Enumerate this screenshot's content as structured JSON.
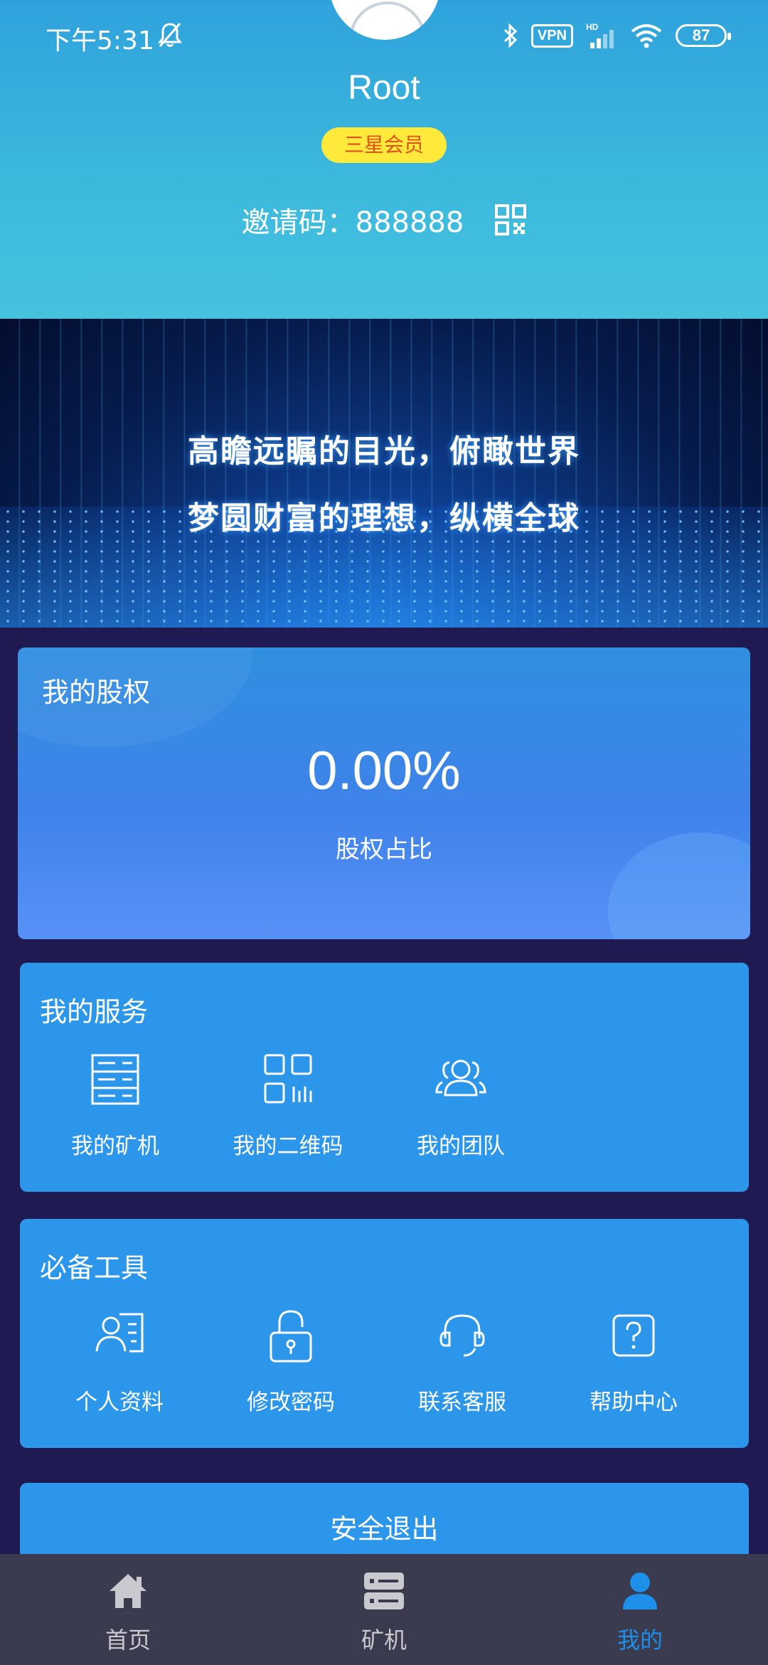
{
  "status_bar": {
    "time": "下午5:31",
    "vpn": "VPN",
    "network": "HD",
    "battery": "87",
    "icons": [
      "bell-muted-icon",
      "bluetooth-icon",
      "vpn-icon",
      "signal-icon",
      "wifi-icon",
      "battery-icon"
    ]
  },
  "profile": {
    "username": "Root",
    "member_level": "三星会员",
    "invite_code": "邀请码：888888"
  },
  "banner": {
    "line1": "高瞻远瞩的目光，俯瞰世界",
    "line2": "梦圆财富的理想，纵横全球"
  },
  "equity": {
    "title": "我的股权",
    "value": "0.00%",
    "label": "股权占比"
  },
  "services": {
    "title": "我的服务",
    "items": [
      {
        "label": "我的矿机",
        "icon": "server-icon"
      },
      {
        "label": "我的二维码",
        "icon": "qrcode-icon"
      },
      {
        "label": "我的团队",
        "icon": "team-icon"
      }
    ]
  },
  "tools": {
    "title": "必备工具",
    "items": [
      {
        "label": "个人资料",
        "icon": "profile-card-icon"
      },
      {
        "label": "修改密码",
        "icon": "lock-icon"
      },
      {
        "label": "联系客服",
        "icon": "headset-icon"
      },
      {
        "label": "帮助中心",
        "icon": "help-icon"
      }
    ]
  },
  "logout": {
    "label": "安全退出"
  },
  "bottom_nav": {
    "items": [
      {
        "label": "首页",
        "icon": "home-icon",
        "active": false
      },
      {
        "label": "矿机",
        "icon": "server-icon",
        "active": false
      },
      {
        "label": "我的",
        "icon": "user-icon",
        "active": true
      }
    ]
  },
  "colors": {
    "header": "#3cb8dd",
    "card": "#2b96ea",
    "background": "#1f1b52",
    "badge": "#ffe93a",
    "badge_text": "#e0501e",
    "nav_bg": "#3a3b4e",
    "nav_active": "#1d8fe8"
  }
}
